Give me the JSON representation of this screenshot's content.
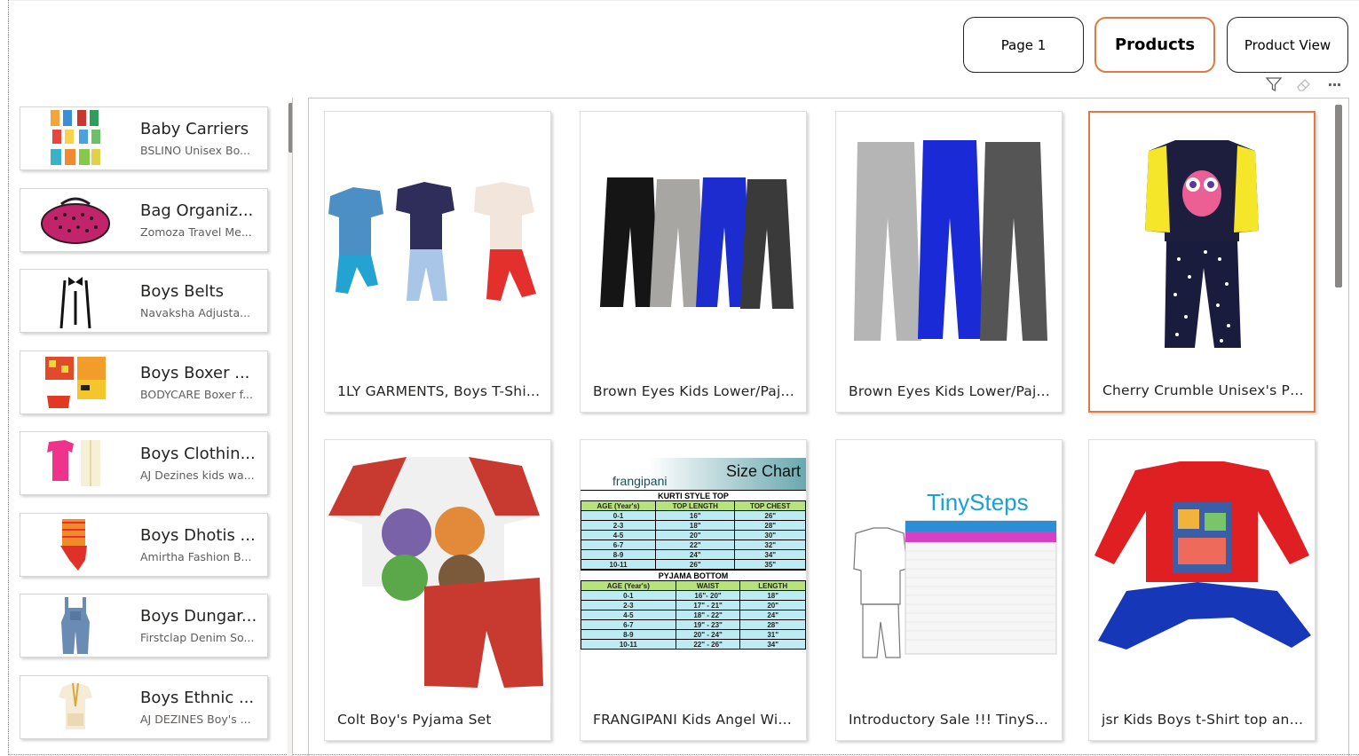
{
  "nav": {
    "buttons": [
      {
        "label": "Page 1",
        "active": false
      },
      {
        "label": "Products",
        "active": true
      },
      {
        "label": "Product View",
        "active": false
      }
    ]
  },
  "visual_header": {
    "icons": [
      "filter-icon",
      "eraser-icon",
      "more-options-icon"
    ],
    "more_glyph": "···"
  },
  "categories": [
    {
      "title": "Baby Carriers",
      "subtitle": "BSLINO Unisex Bo..."
    },
    {
      "title": "Bag Organiz...",
      "subtitle": "Zomoza Travel Me..."
    },
    {
      "title": "Boys Belts",
      "subtitle": "Navaksha Adjusta..."
    },
    {
      "title": "Boys Boxer ...",
      "subtitle": "BODYCARE Boxer f..."
    },
    {
      "title": "Boys Clothin...",
      "subtitle": "AJ Dezines kids wa..."
    },
    {
      "title": "Boys Dhotis ...",
      "subtitle": "Amirtha Fashion B..."
    },
    {
      "title": "Boys Dungar...",
      "subtitle": "Firstclap Denim So..."
    },
    {
      "title": "Boys Ethnic ...",
      "subtitle": "AJ DEZINES Boy's ..."
    }
  ],
  "products": [
    {
      "title": "1LY GARMENTS, Boys T-Shi...",
      "selected": false
    },
    {
      "title": "Brown Eyes Kids Lower/Paj...",
      "selected": false
    },
    {
      "title": "Brown Eyes Kids Lower/Paj...",
      "selected": false
    },
    {
      "title": "Cherry Crumble Unisex's Py...",
      "selected": true
    },
    {
      "title": "Colt Boy's Pyjama Set",
      "selected": false
    },
    {
      "title": "FRANGIPANI Kids Angel Win...",
      "selected": false
    },
    {
      "title": "Introductory Sale !!! TinyStep...",
      "selected": false
    },
    {
      "title": "jsr Kids Boys t-Shirt top and...",
      "selected": false
    }
  ],
  "size_chart": {
    "brand": "frangipani",
    "heading": "Size Chart",
    "top_section": "KURTI STYLE TOP",
    "top_headers": [
      "AGE (Year's)",
      "TOP LENGTH",
      "TOP CHEST"
    ],
    "top_rows": [
      [
        "0-1",
        "16\"",
        "26\""
      ],
      [
        "2-3",
        "18\"",
        "28\""
      ],
      [
        "4-5",
        "20\"",
        "30\""
      ],
      [
        "6-7",
        "22\"",
        "32\""
      ],
      [
        "8-9",
        "24\"",
        "34\""
      ],
      [
        "10-11",
        "26\"",
        "35\""
      ]
    ],
    "bottom_section": "PYJAMA BOTTOM",
    "bottom_headers": [
      "AGE (Year's)",
      "WAIST",
      "LENGTH"
    ],
    "bottom_rows": [
      [
        "0-1",
        "16\"- 20\"",
        "18\""
      ],
      [
        "2-3",
        "17\" - 21\"",
        "20\""
      ],
      [
        "4-5",
        "18\" - 22\"",
        "24\""
      ],
      [
        "6-7",
        "19\" - 23\"",
        "28\""
      ],
      [
        "8-9",
        "20\" - 24\"",
        "31\""
      ],
      [
        "10-11",
        "22\" - 26\"",
        "34\""
      ]
    ]
  },
  "tinysteps_logo": "TinySteps",
  "colors": {
    "accent": "#e07a45",
    "border": "#252423",
    "scrollbar": "#8a8886"
  }
}
